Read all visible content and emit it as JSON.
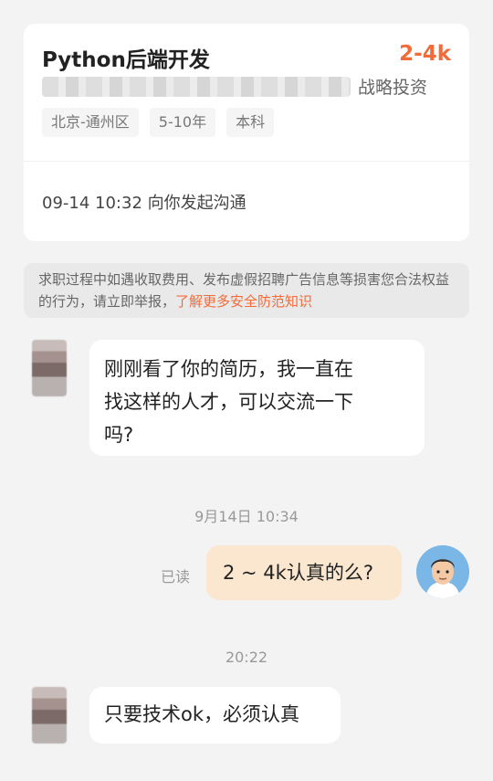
{
  "job": {
    "title": "Python后端开发",
    "salary": "2-4k",
    "company_suffix": "战略投资",
    "tags": [
      "北京-通州区",
      "5-10年",
      "本科"
    ],
    "contact_line": "09-14 10:32 向你发起沟通"
  },
  "notice": {
    "text": "求职过程中如遇收取费用、发布虚假招聘广告信息等损害您合法权益的行为，请立即举报，",
    "link_text": "了解更多安全防范知识"
  },
  "messages": {
    "first": {
      "line1": "刚刚看了你的简历，我一直在",
      "line2": "找这样的人才，可以交流一下",
      "line3": "吗?"
    },
    "time1": "9月14日 10:34",
    "mine": {
      "status": "已读",
      "text": "2 ~ 4k认真的么?"
    },
    "time2": "20:22",
    "reply": "只要技术ok，必须认真"
  },
  "colors": {
    "accent": "#f26b3a",
    "mine_bubble": "#fbe7cf"
  }
}
